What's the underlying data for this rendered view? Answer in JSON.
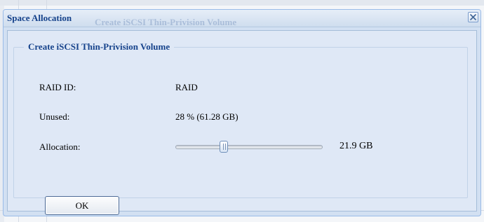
{
  "dialog": {
    "title": "Space Allocation",
    "background_title": "Create iSCSI Thin-Privision Volume",
    "close_icon": "close-icon"
  },
  "group": {
    "legend": "Create iSCSI Thin-Privision Volume",
    "raid_id_label": "RAID ID:",
    "raid_id_value": "RAID",
    "unused_label": "Unused:",
    "unused_value": "28 % (61.28 GB)",
    "allocation_label": "Allocation:",
    "allocation_value": "21.9 GB",
    "allocation_slider_fraction": 0.33
  },
  "buttons": {
    "ok_label": "OK"
  },
  "colors": {
    "title_text": "#15428b",
    "window_border": "#99bbe8",
    "body_background": "#dfe8f6"
  }
}
